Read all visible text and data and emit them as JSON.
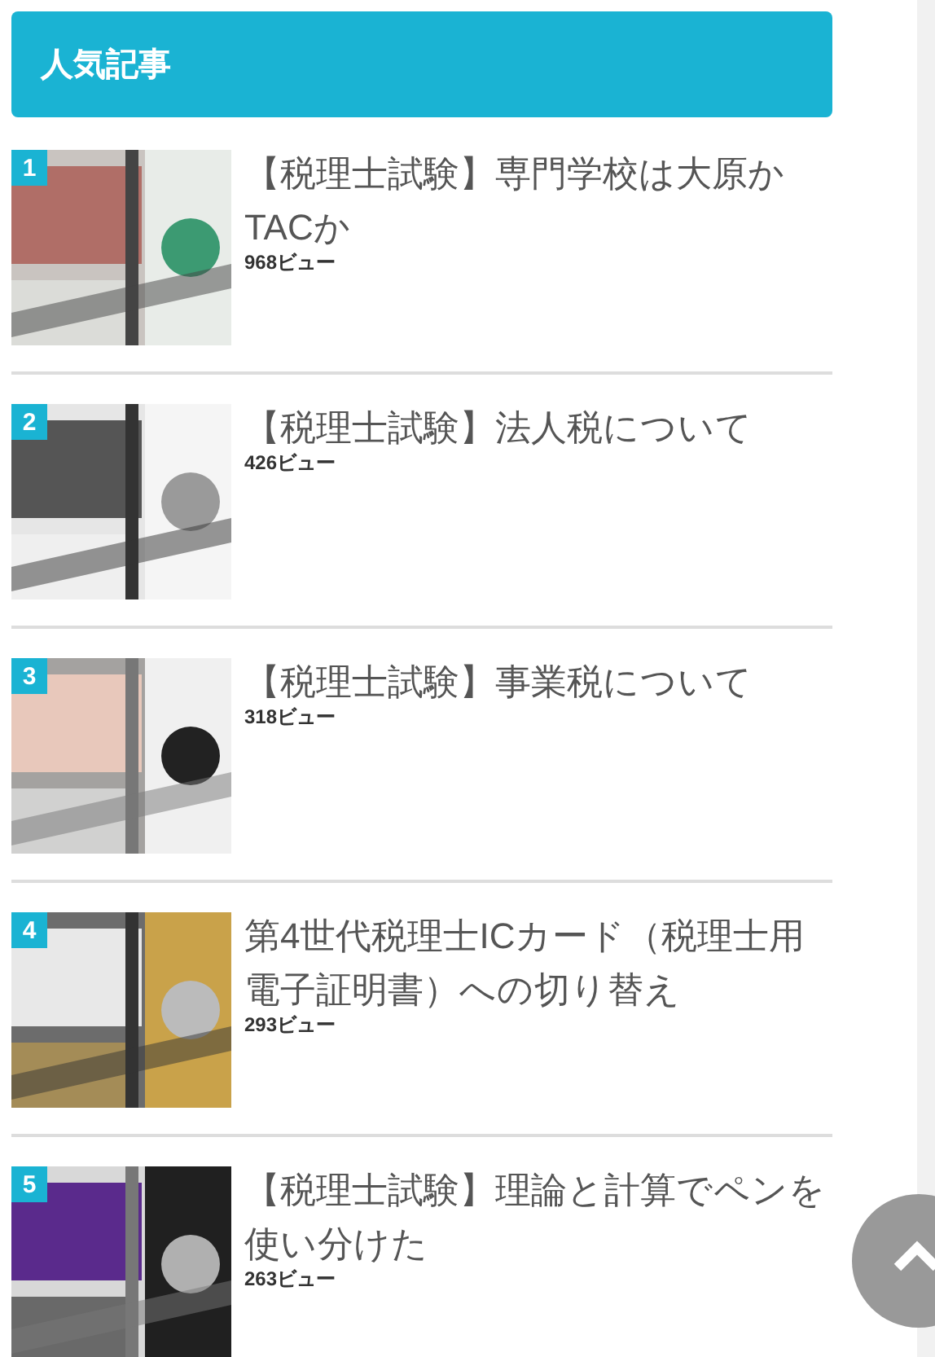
{
  "widget": {
    "title": "人気記事"
  },
  "articles": [
    {
      "rank": "1",
      "title": "【税理士試験】専門学校は大原かTACか",
      "views": "968ビュー"
    },
    {
      "rank": "2",
      "title": "【税理士試験】法人税について",
      "views": "426ビュー"
    },
    {
      "rank": "3",
      "title": "【税理士試験】事業税について",
      "views": "318ビュー"
    },
    {
      "rank": "4",
      "title": "第4世代税理士ICカード（税理士用電子証明書）への切り替え",
      "views": "293ビュー"
    },
    {
      "rank": "5",
      "title": "【税理士試験】理論と計算でペンを使い分けた",
      "views": "263ビュー"
    }
  ]
}
